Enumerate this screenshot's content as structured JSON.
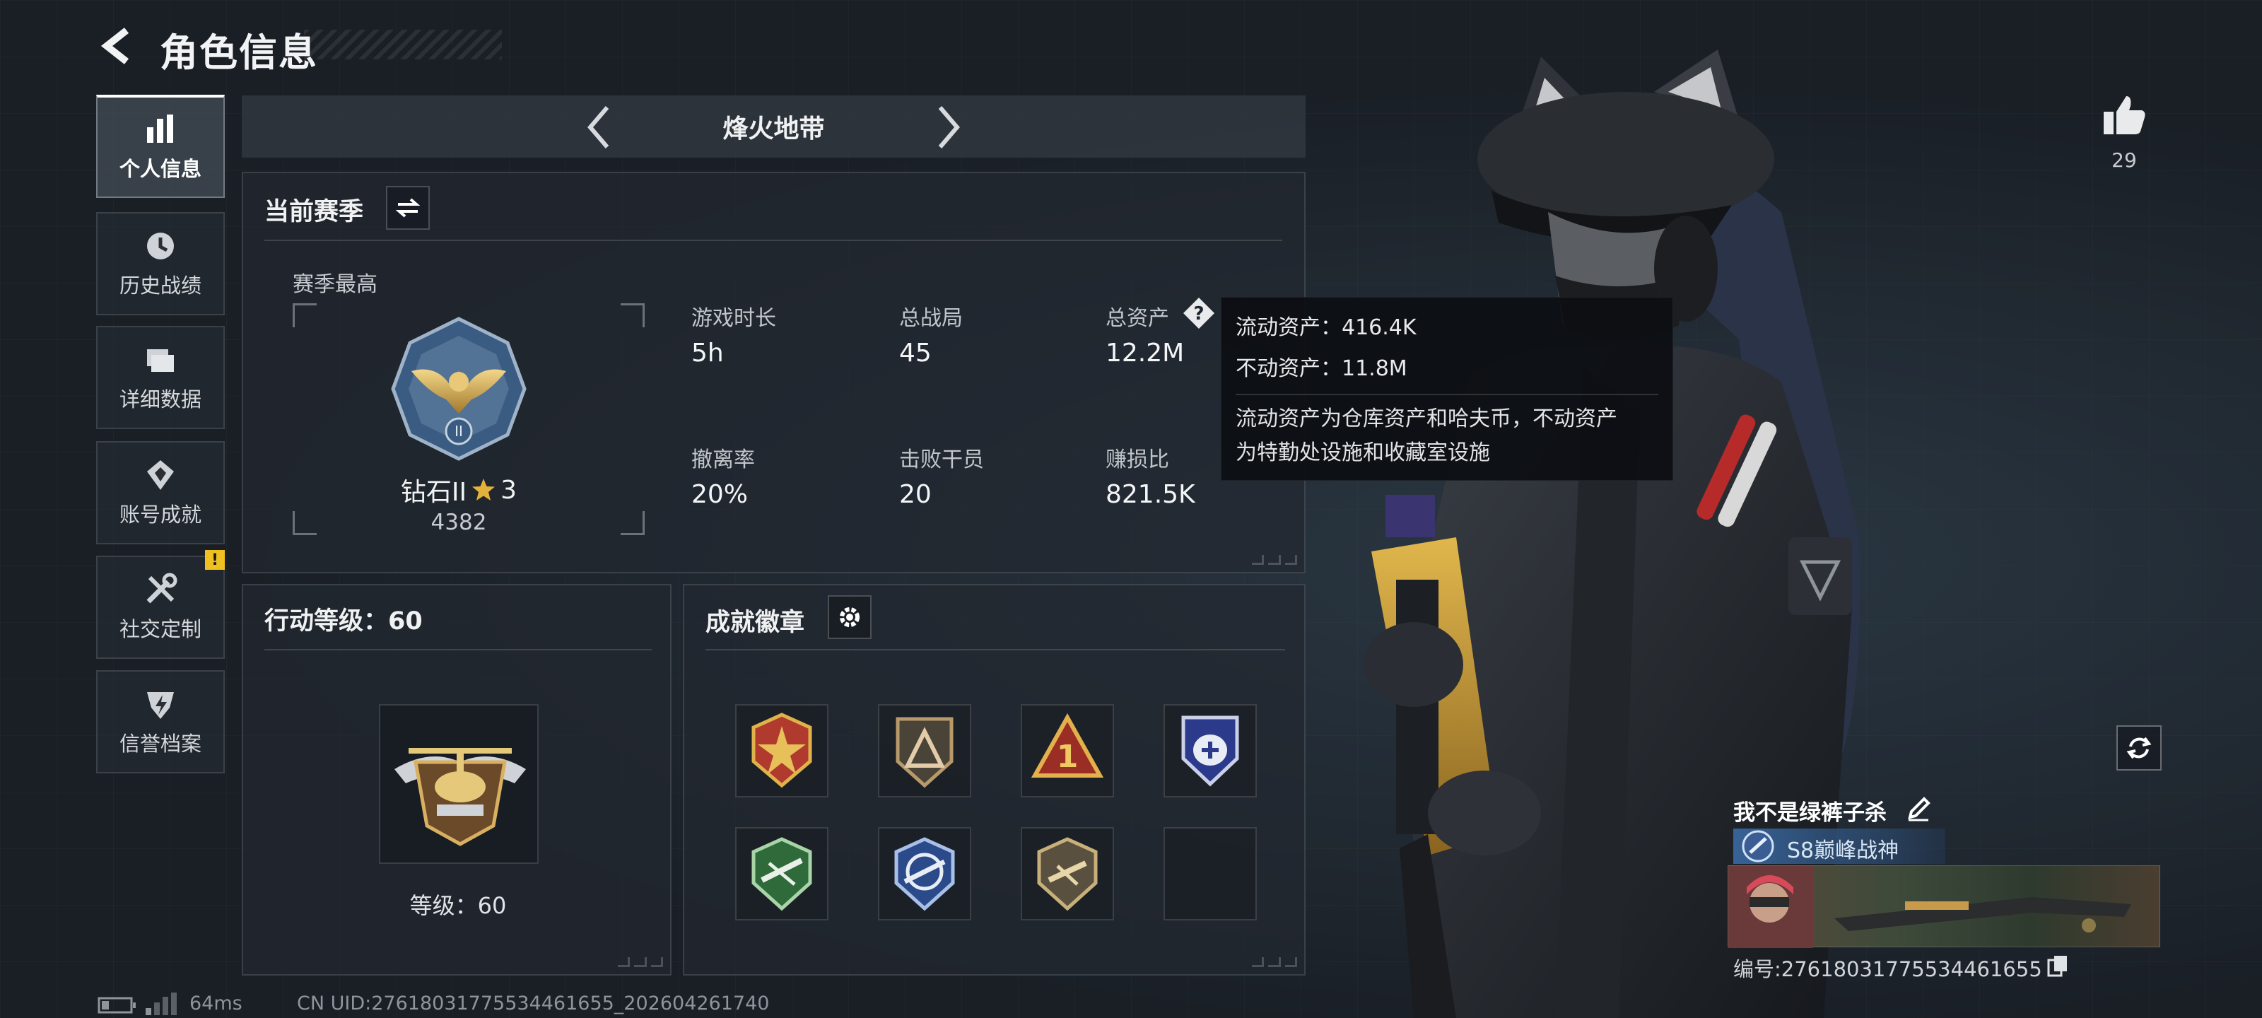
{
  "header": {
    "title": "角色信息"
  },
  "sidebar": {
    "items": [
      {
        "label": "个人信息",
        "active": true,
        "icon": "bar-chart-icon"
      },
      {
        "label": "历史战绩",
        "active": false,
        "icon": "clock-icon"
      },
      {
        "label": "详细数据",
        "active": false,
        "icon": "folder-icon"
      },
      {
        "label": "账号成就",
        "active": false,
        "icon": "trophy-icon"
      },
      {
        "label": "社交定制",
        "active": false,
        "icon": "tools-icon",
        "badge": "!"
      },
      {
        "label": "信誉档案",
        "active": false,
        "icon": "shield-icon"
      }
    ]
  },
  "mode": {
    "name": "烽火地带"
  },
  "season": {
    "title": "当前赛季",
    "best_label": "赛季最高",
    "rank_name": "钻石II",
    "rank_stars": "3",
    "rank_score": "4382",
    "stats": [
      {
        "label": "游戏时长",
        "value": "5h"
      },
      {
        "label": "总战局",
        "value": "45"
      },
      {
        "label": "总资产",
        "value": "12.2M"
      },
      {
        "label": "撤离率",
        "value": "20%"
      },
      {
        "label": "击败干员",
        "value": "20"
      },
      {
        "label": "赚损比",
        "value": "821.5K"
      }
    ]
  },
  "action_level": {
    "title": "行动等级：60",
    "level_label": "等级：60"
  },
  "achievements": {
    "title": "成就徽章",
    "badges": [
      "star-cross-badge-icon",
      "triangle-badge-icon",
      "number-one-badge-icon",
      "blue-wing-badge-icon",
      "green-rifle-badge-icon",
      "blue-rifle-badge-icon",
      "gold-rifle-badge-icon",
      "empty"
    ]
  },
  "tooltip": {
    "line1": "流动资产：416.4K",
    "line2": "不动资产：11.8M",
    "desc1": "流动资产为仓库资产和哈夫币，不动资产",
    "desc2": "为特勤处设施和收藏室设施"
  },
  "profile": {
    "likes": "29",
    "player_name": "我不是绿裤子杀",
    "title_text": "S8巅峰战神",
    "uid_line": "编号:27618031775534461655"
  },
  "footer": {
    "ping": "64ms",
    "uid": "CN UID:27618031775534461655_202604261740"
  },
  "colors": {
    "accent_gold": "#c9a24a",
    "tooltip_bg": "#0c0e12",
    "warn": "#f0c020",
    "title_blue": "#3c6eaa"
  }
}
